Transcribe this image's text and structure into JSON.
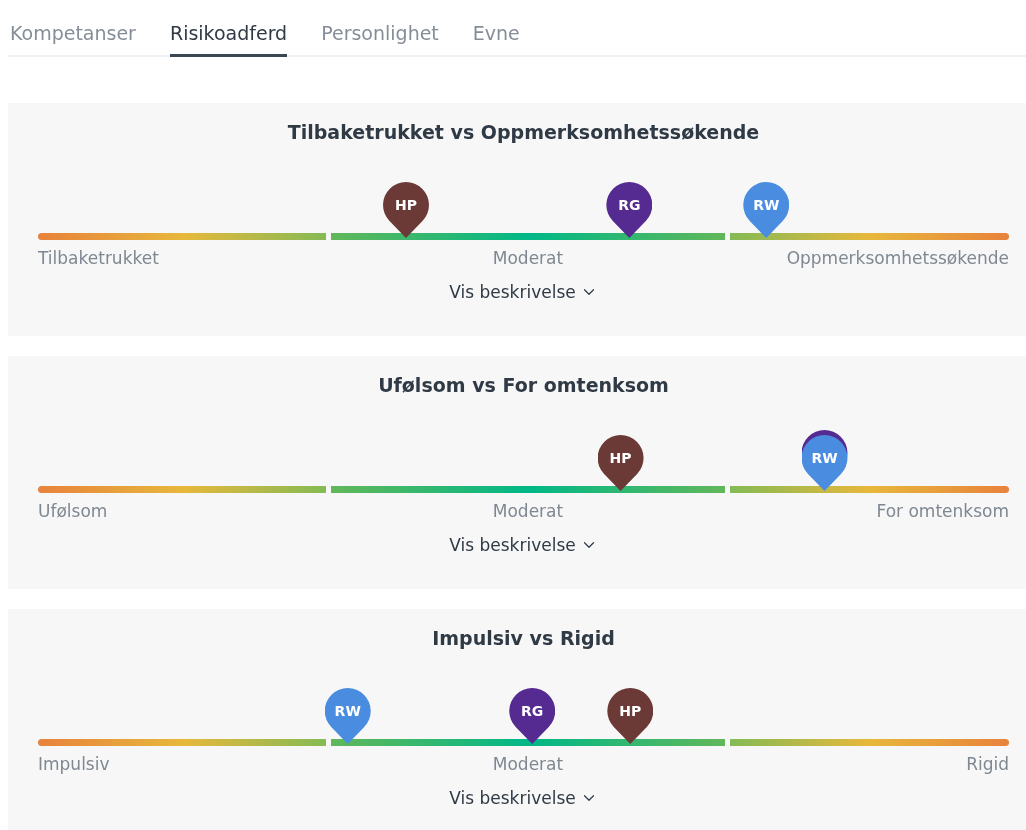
{
  "tabs": [
    {
      "label": "Kompetanser",
      "selected": false
    },
    {
      "label": "Risikoadferd",
      "selected": true
    },
    {
      "label": "Personlighet",
      "selected": false
    },
    {
      "label": "Evne",
      "selected": false
    }
  ],
  "sections": [
    {
      "title": "Tilbaketrukket vs Oppmerksomhetssøkende",
      "scale_labels": [
        "Tilbaketrukket",
        "Moderat",
        "Oppmerksomhetssøkende"
      ],
      "toggle": "Vis beskrivelse",
      "markers": [
        {
          "kind": "pin",
          "label": "HP",
          "color": "#6b3a36",
          "level": 0.379
        },
        {
          "kind": "pin",
          "label": "RG",
          "color": "#552a91",
          "level": 0.609
        },
        {
          "kind": "pin",
          "label": "RW",
          "color": "#4a8de0",
          "level": 0.75
        }
      ]
    },
    {
      "title": "Ufølsom vs For omtenksom",
      "scale_labels": [
        "Ufølsom",
        "Moderat",
        "For omtenksom"
      ],
      "toggle": "Vis beskrivelse",
      "markers": [
        {
          "kind": "pin",
          "label": "HP",
          "color": "#6b3a36",
          "level": 0.6
        },
        {
          "kind": "hidden-pin",
          "color": "#552a91",
          "level": 0.81
        },
        {
          "kind": "pin",
          "label": "RW",
          "color": "#4a8de0",
          "level": 0.81
        }
      ]
    },
    {
      "title": "Impulsiv vs Rigid",
      "scale_labels": [
        "Impulsiv",
        "Moderat",
        "Rigid"
      ],
      "toggle": "Vis beskrivelse",
      "markers": [
        {
          "kind": "pin",
          "label": "RW",
          "color": "#4a8de0",
          "level": 0.319
        },
        {
          "kind": "pin",
          "label": "RG",
          "color": "#552a91",
          "level": 0.509
        },
        {
          "kind": "pin",
          "label": "HP",
          "color": "#6b3a36",
          "level": 0.61
        }
      ]
    }
  ]
}
